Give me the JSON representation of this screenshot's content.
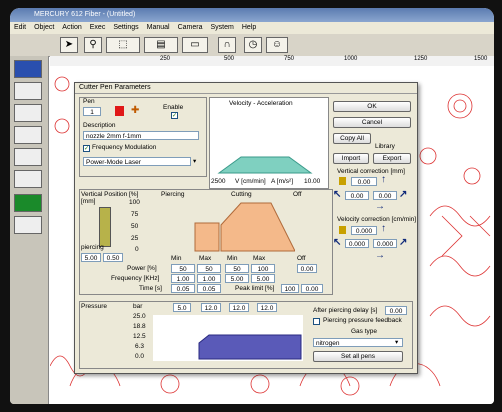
{
  "app": {
    "title": "MERCURY 612 Fiber - (Untitled)"
  },
  "menu": {
    "items": [
      "Edit",
      "Object",
      "Action",
      "Exec",
      "Settings",
      "Manual",
      "Camera",
      "System",
      "Help"
    ]
  },
  "ruler": {
    "ticks": [
      "250",
      "500",
      "750",
      "1000",
      "1250",
      "1500"
    ]
  },
  "dialog": {
    "title": "Cutter Pen Parameters",
    "pen_label": "Pen",
    "pen_value": "1",
    "enable_label": "Enable",
    "description_label": "Description",
    "description_value": "nozzle 2mm f-1mm",
    "freq_mod_label": "Frequency Modulation",
    "mode_value": "Power-Mode Laser",
    "velocity_title": "Velocity - Acceleration",
    "vel_min": "2500",
    "vel_unit": "V [cm/min]",
    "acc_unit": "A [m/s²]",
    "acc_value": "10.00",
    "ok": "OK",
    "cancel": "Cancel",
    "copy_all": "Copy All",
    "library_label": "Library",
    "import": "Import",
    "export": "Export",
    "vert_corr_label": "Vertical correction [mm]",
    "vert_val1": "0.00",
    "vert_val2": "0.00",
    "vert_val3": "0.00",
    "vel_corr_label": "Velocity correction [cm/min]",
    "vel_val1": "0.000",
    "vel_val2": "0.000",
    "vel_val3": "0.000",
    "vp_label": "Vertical Position\n[mm]",
    "piercing_label": "piercing",
    "vp_val1": "5.00",
    "vp_val2": "0.50",
    "pct_label": "[%]",
    "piercing_col": "Piercing",
    "cutting_col": "Cutting",
    "off_col": "Off",
    "y_ticks": [
      "100",
      "75",
      "50",
      "25",
      "0"
    ],
    "min_label": "Min",
    "max_label": "Max",
    "off_label": "Off",
    "power_label": "Power [%]",
    "power_vals": [
      "50",
      "50",
      "50",
      "100"
    ],
    "freq_label": "Frequency [KHz]",
    "freq_vals": [
      "1.00",
      "1.00",
      "5.00",
      "5.00"
    ],
    "time_label": "Time [s]",
    "time_vals": [
      "0.05",
      "0.05"
    ],
    "peak_label": "Peak limit [%]",
    "peak_vals": [
      "100",
      "0.00"
    ],
    "off_val": "0.00",
    "pressure_label": "Pressure",
    "bar_label": "bar",
    "pressure_vals": [
      "5.0",
      "12.0",
      "12.0",
      "12.0"
    ],
    "p_ticks": [
      "25.0",
      "18.8",
      "12.5",
      "6.3",
      "0.0"
    ],
    "after_pierce_label": "After piercing delay [s]",
    "after_pierce_val": "0.00",
    "pierce_feedback_label": "Piercing pressure feedback",
    "gas_type_label": "Gas type",
    "gas_value": "nitrogen",
    "set_all_pens": "Set all pens"
  },
  "colors": {
    "accent_orange": "#f4b98a",
    "pen_red": "#e01818",
    "purple": "#5a5ab8",
    "cut_red": "#d33333"
  }
}
